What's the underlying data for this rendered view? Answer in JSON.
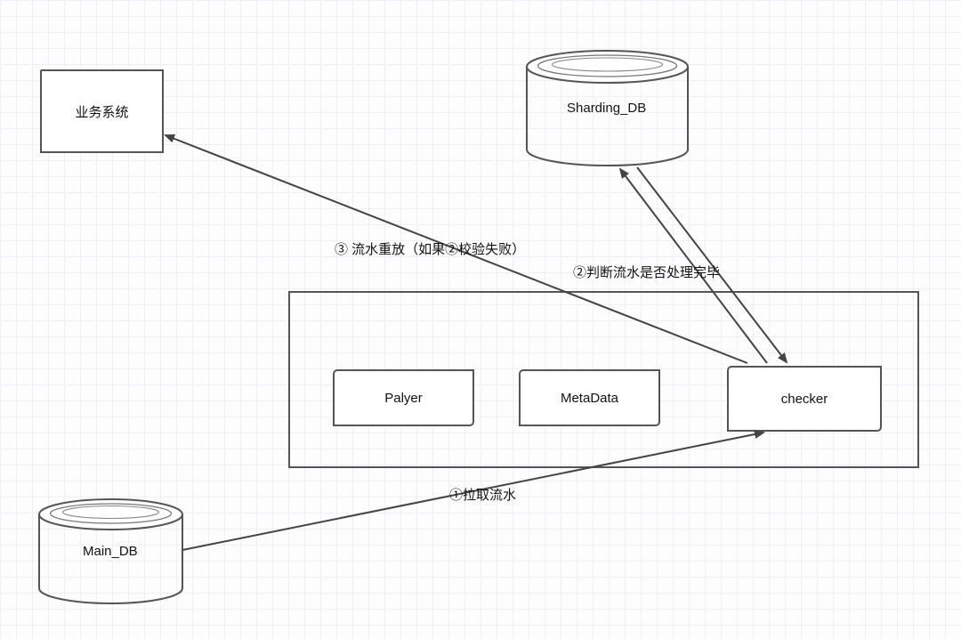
{
  "nodes": {
    "business_system": "业务系统",
    "sharding_db": "Sharding_DB",
    "main_db": "Main_DB",
    "player": "Palyer",
    "metadata": "MetaData",
    "checker": "checker"
  },
  "edges": {
    "step1": "①拉取流水",
    "step2": "②判断流水是否处理完毕",
    "step3": "③ 流水重放（如果②校验失败）"
  }
}
